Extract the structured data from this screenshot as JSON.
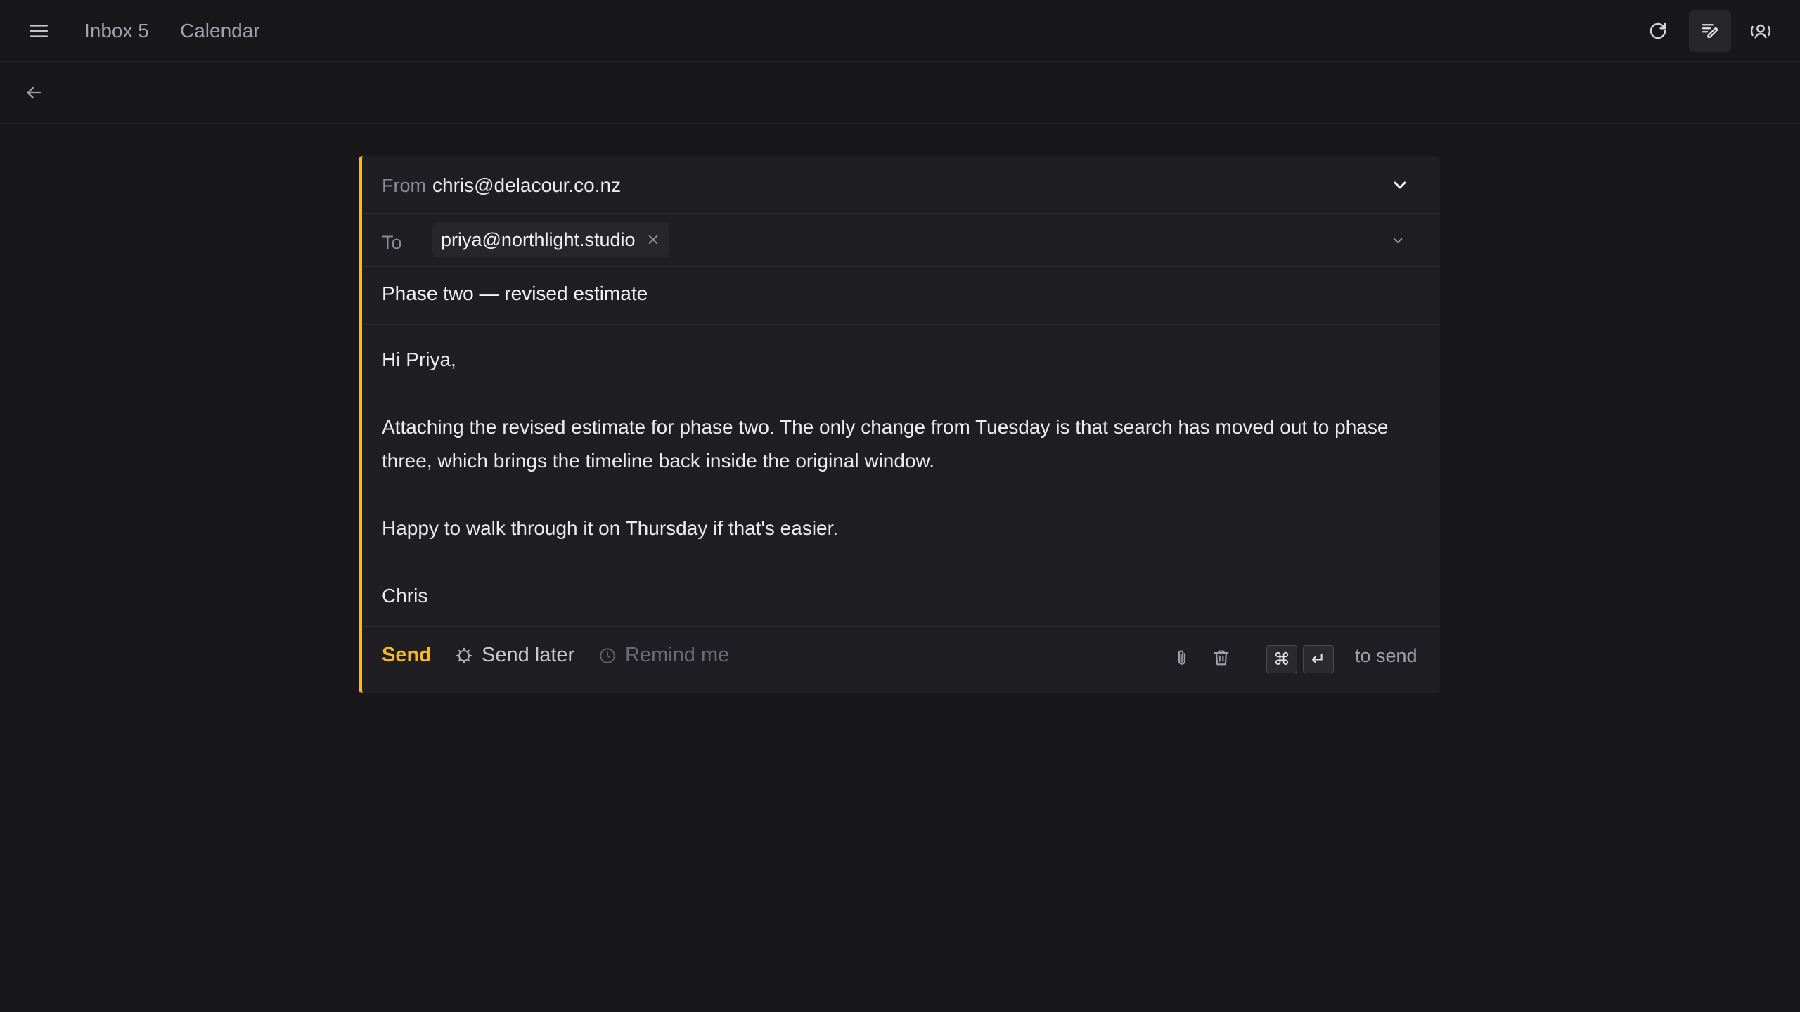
{
  "nav": {
    "inbox_label": "Inbox 5",
    "calendar_label": "Calendar"
  },
  "icons": {
    "menu": "menu-icon",
    "refresh": "refresh-icon",
    "compose": "compose-icon",
    "account": "account-icon",
    "back": "arrow-left-icon",
    "attach": "paperclip-icon",
    "trash": "trash-icon"
  },
  "composer": {
    "from_label": "From",
    "from_value": "chris@delacour.co.nz",
    "to_label": "To",
    "recipients": [
      {
        "email": "priya@northlight.studio"
      }
    ],
    "subject": "Phase two — revised estimate",
    "body": [
      "Hi Priya,",
      "Attaching the revised estimate for phase two. The only change from Tuesday is that search has moved out to phase three, which brings the timeline back inside the original window.",
      "Happy to walk through it on Thursday if that's easier.",
      "Chris"
    ]
  },
  "footer": {
    "send_label": "Send",
    "send_later_label": "Send later",
    "remind_label": "Remind me",
    "kbd_cmd": "⌘",
    "kbd_enter": "↵",
    "to_send_label": "to send"
  },
  "colors": {
    "accent": "#f5b82e",
    "background": "#18181b",
    "panel": "#1f1f23"
  }
}
